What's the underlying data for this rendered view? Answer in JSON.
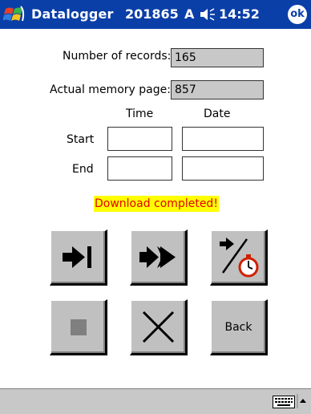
{
  "titlebar": {
    "app_title": "Datalogger",
    "device_id": "201865",
    "input_mode": "A",
    "time": "14:52",
    "ok_label": "ok"
  },
  "fields": {
    "records_label": "Number of records:",
    "records_value": "165",
    "memory_label": "Actual memory page:",
    "memory_value": "857",
    "time_header": "Time",
    "date_header": "Date",
    "start_label": "Start",
    "end_label": "End",
    "start_time": "",
    "start_date": "",
    "end_time": "",
    "end_date": ""
  },
  "status": {
    "message": "Download completed!",
    "bg_color": "#ffff00",
    "text_color": "#e00000"
  },
  "buttons": {
    "back_label": "Back",
    "icons": [
      "skip-to-end-icon",
      "fast-forward-icon",
      "timer-icon",
      "stop-icon",
      "close-icon"
    ]
  },
  "taskbar": {
    "icons": [
      "keyboard-icon",
      "arrow-up-icon"
    ]
  },
  "colors": {
    "titlebar": "#0a3fa8",
    "button_face": "#c0c0c0",
    "readonly_field": "#c8c8c8"
  }
}
